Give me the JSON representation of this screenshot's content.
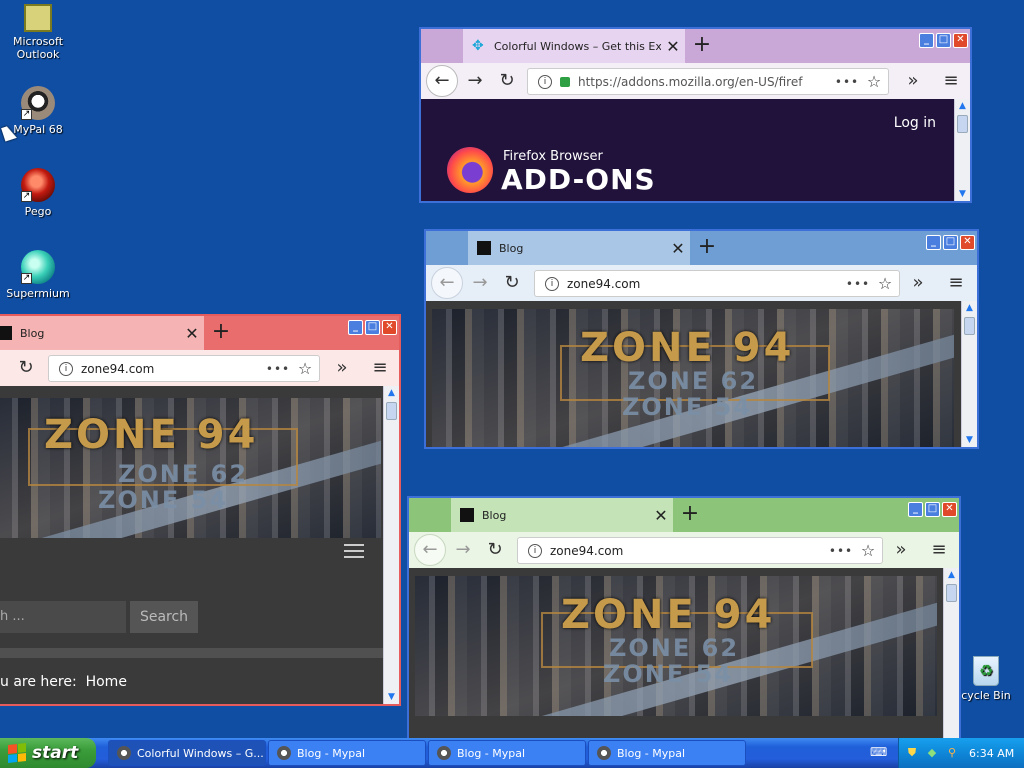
{
  "desktop": {
    "icons": [
      {
        "label": "Microsoft Outlook",
        "icon": "outlook-icon"
      },
      {
        "label": "MyPal 68",
        "icon": "mypal-icon"
      },
      {
        "label": "Pego",
        "icon": "pego-icon"
      },
      {
        "label": "Supermium",
        "icon": "supermium-icon"
      },
      {
        "label": "cycle Bin",
        "icon": "recycle-bin-icon"
      }
    ]
  },
  "windows": {
    "addons": {
      "tab_title": "Colorful Windows – Get this Exten",
      "url": "https://addons.mozilla.org/en-US/firef",
      "login": "Log in",
      "brand_top": "Firefox Browser",
      "brand_bottom": "ADD-ONS",
      "accent": "#c9a8d8"
    },
    "blue": {
      "tab_title": "Blog",
      "url": "zone94.com",
      "accent": "#a9c6e6"
    },
    "red": {
      "tab_title": "Blog",
      "url": "zone94.com",
      "search_placeholder": "h ...",
      "search_button": "Search",
      "breadcrumb_prefix": "u are here:",
      "breadcrumb_home": "Home",
      "accent": "#f2a6a6"
    },
    "green": {
      "tab_title": "Blog",
      "url": "zone94.com",
      "accent": "#a8d49a"
    }
  },
  "banner": {
    "line1": "ZONE 94",
    "line2": "ZONE 62",
    "line3": "ZONE 54"
  },
  "taskbar": {
    "start": "start",
    "tasks": [
      {
        "label": "Colorful Windows – G...",
        "icon": "firefox-icon"
      },
      {
        "label": "Blog - Mypal",
        "icon": "mypal-icon"
      },
      {
        "label": "Blog - Mypal",
        "icon": "mypal-icon"
      },
      {
        "label": "Blog - Mypal",
        "icon": "mypal-icon"
      }
    ],
    "clock": "6:34 AM"
  }
}
